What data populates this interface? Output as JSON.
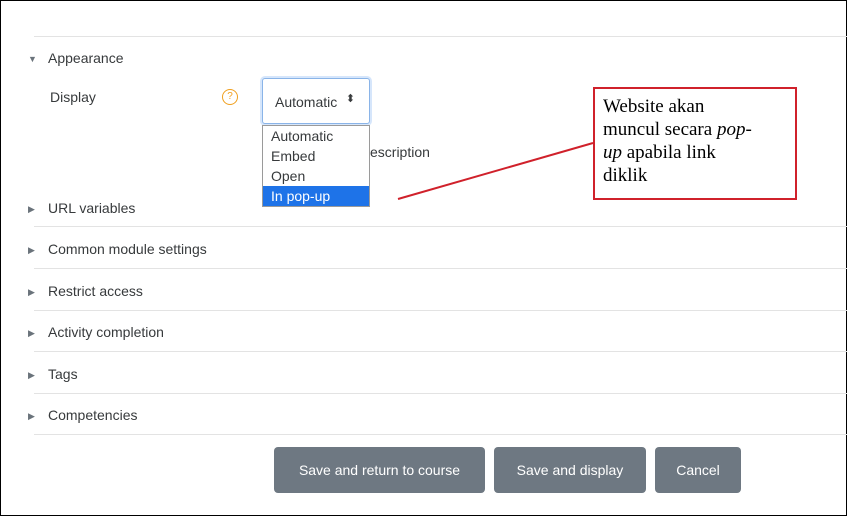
{
  "sections": {
    "appearance": "Appearance",
    "url_variables": "URL variables",
    "common_module_settings": "Common module settings",
    "restrict_access": "Restrict access",
    "activity_completion": "Activity completion",
    "tags": "Tags",
    "competencies": "Competencies"
  },
  "display_field": {
    "label": "Display",
    "help_icon": "?",
    "selected_value": "Automatic",
    "options": [
      "Automatic",
      "Embed",
      "Open",
      "In pop-up"
    ],
    "highlighted_option": "In pop-up",
    "partial_text": "escription"
  },
  "callout": {
    "line1": "Website akan",
    "line2a": "muncul secara ",
    "line2b": "pop-",
    "line3a": "up",
    "line3b": " apabila link",
    "line4": "diklik"
  },
  "buttons": {
    "save_return": "Save and return to course",
    "save_display": "Save and display",
    "cancel": "Cancel"
  },
  "colors": {
    "button_bg": "#6e7882",
    "selected_option_bg": "#1e73e8",
    "callout_border": "#d0212b",
    "help_icon": "#f0a020"
  },
  "icons": {
    "expanded": "triangle-down-icon",
    "collapsed": "triangle-right-icon",
    "help": "question-circle-icon",
    "select_arrows": "sort-arrows-icon"
  }
}
